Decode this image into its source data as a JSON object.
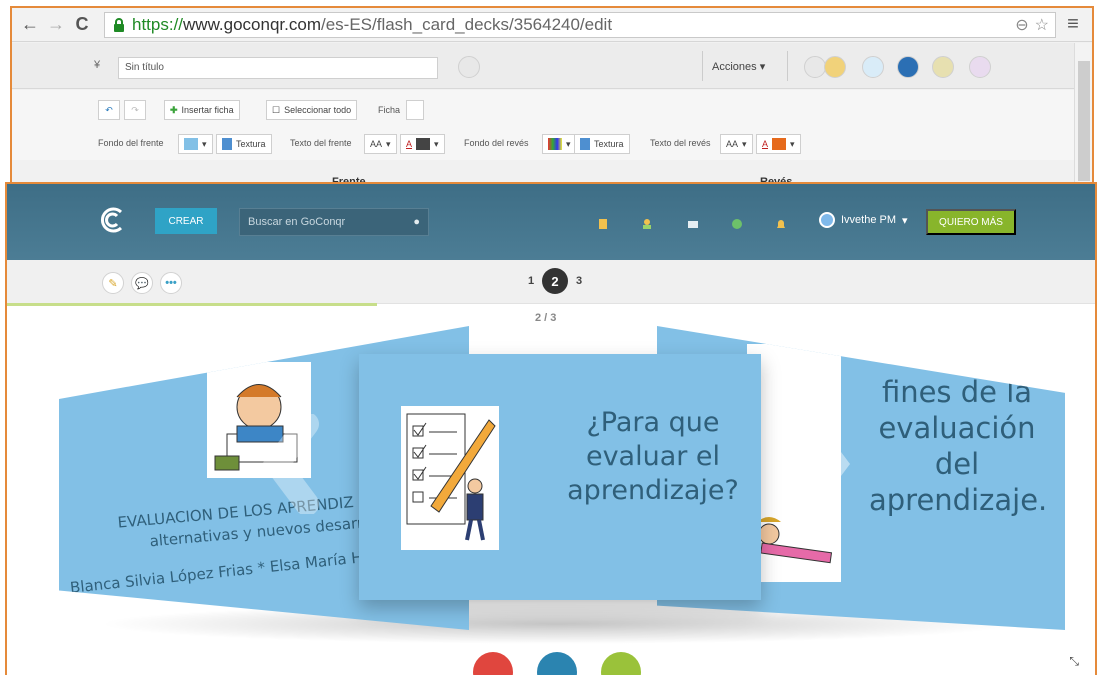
{
  "browser": {
    "url_scheme": "https://",
    "url_host": "www.goconqr.com",
    "url_path": "/es-ES/flash_card_decks/3564240/edit"
  },
  "editor": {
    "title_value": "Sin título",
    "acciones_label": "Acciones",
    "insert_card_label": "Insertar ficha",
    "select_all_label": "Seleccionar todo",
    "card_label": "Ficha",
    "front_bg_label": "Fondo del frente",
    "texture_label": "Textura",
    "front_text_label": "Texto del frente",
    "back_bg_label": "Fondo del revés",
    "back_text_label": "Texto del revés",
    "font_size_glyph": "AA",
    "font_color_glyph": "A",
    "col_front": "Frente",
    "col_back": "Revés"
  },
  "goconqr": {
    "crear_label": "CREAR",
    "search_placeholder": "Buscar en GoConqr",
    "user_name": "Ivvethe PM",
    "quiero_label": "QUIERO MÁS",
    "pages": [
      "1",
      "2",
      "3"
    ],
    "counter": "2 / 3",
    "progress_fraction": 0.34
  },
  "cards": {
    "left_title": "EVALUACION DE LOS APRENDIZ",
    "left_sub": "alternativas y nuevos desarrol",
    "left_authors": "Blanca Silvia López Frias * Elsa María Hi",
    "center_text": "¿Para que evaluar el aprendizaje?",
    "right_text": "fines de la evaluación del aprendizaje."
  },
  "colors": {
    "card_blue": "#82c0e6",
    "header_blue": "#44758d",
    "crear": "#2fa3c6",
    "quiero": "#88b52b",
    "window_border": "#e58a3a"
  }
}
